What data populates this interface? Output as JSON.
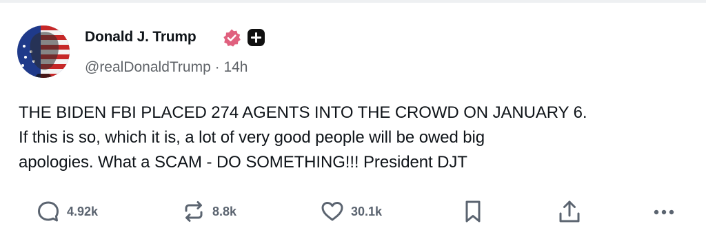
{
  "post": {
    "author": {
      "display_name": "Donald J. Trump",
      "handle": "@realDonaldTrump",
      "separator": " · ",
      "time": "14h"
    },
    "text_lines": [
      "THE BIDEN FBI PLACED 274 AGENTS INTO THE CROWD ON JANUARY 6.",
      "If this is so, which it is, a lot of very good people will be owed big",
      "apologies. What a SCAM - DO SOMETHING!!! President DJT"
    ]
  },
  "actions": {
    "reply": {
      "icon": "reply-icon",
      "count": "4.92k"
    },
    "repost": {
      "icon": "repost-icon",
      "count": "8.8k"
    },
    "like": {
      "icon": "heart-icon",
      "count": "30.1k"
    },
    "bookmark": {
      "icon": "bookmark-icon"
    },
    "share": {
      "icon": "share-icon"
    },
    "more": {
      "icon": "more-icon"
    }
  },
  "colors": {
    "verified_badge": "#e0607e",
    "text": "#0f1419",
    "muted": "#5f6368",
    "action_gray": "#5b6470"
  }
}
